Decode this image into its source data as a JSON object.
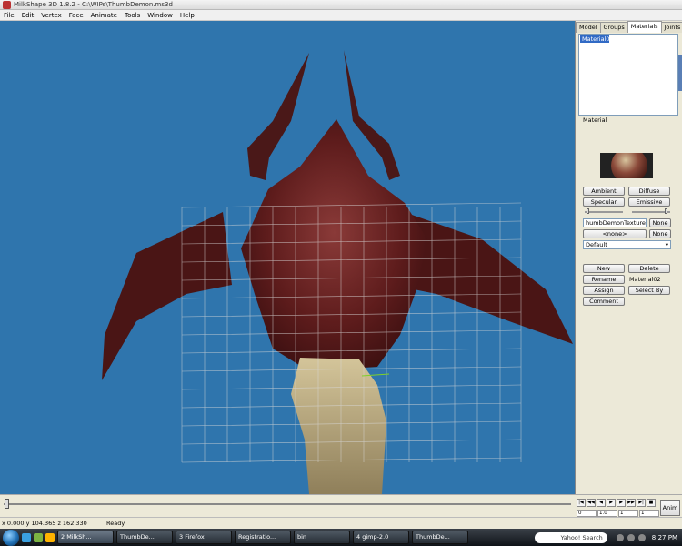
{
  "window": {
    "title": "MilkShape 3D 1.8.2 - C:\\WIPs\\ThumbDemon.ms3d"
  },
  "menu": [
    "File",
    "Edit",
    "Vertex",
    "Face",
    "Animate",
    "Tools",
    "Window",
    "Help"
  ],
  "tabs": [
    "Model",
    "Groups",
    "Materials",
    "Joints"
  ],
  "materials_list": [
    "Material02"
  ],
  "material_section": "Material",
  "buttons": {
    "ambient": "Ambient",
    "diffuse": "Diffuse",
    "specular": "Specular",
    "emissive": "Emissive",
    "none1": "None",
    "none_center": "<none>",
    "none2": "None",
    "new": "New",
    "delete": "Delete",
    "rename": "Rename",
    "assign": "Assign",
    "select_by": "Select By",
    "comment": "Comment"
  },
  "texture_field": "humbDemonTexture.tg",
  "mode_select": "Default",
  "material_name": "Material02",
  "timeline": {
    "fields": [
      "0",
      "1.0",
      "1",
      "1"
    ],
    "anim_label": "Anim"
  },
  "status": {
    "coords": "x 0.000 y 104.365 z 162.330",
    "text": "Ready"
  },
  "taskbar": {
    "tasks": [
      "2 MilkSh...",
      "ThumbDe...",
      "3 Firefox",
      "Registratio...",
      "bin",
      "4 gimp-2.0",
      "ThumbDe..."
    ],
    "search": "Yahoo! Search",
    "clock": "8:27 PM"
  },
  "colors": {
    "viewport": "#2f75ad",
    "accent": "#316ac5"
  }
}
